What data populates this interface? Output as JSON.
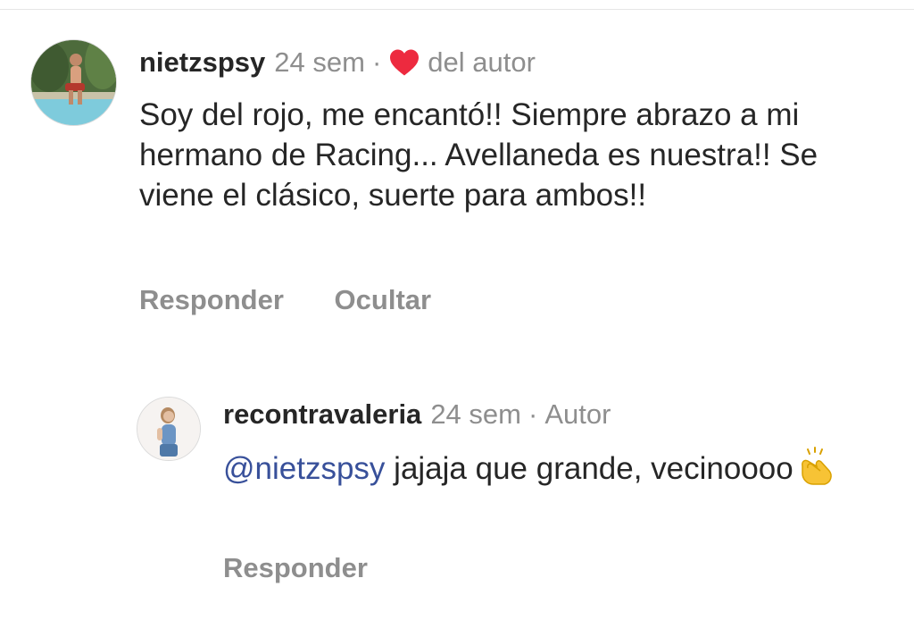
{
  "comments": [
    {
      "username": "nietzspsy",
      "time": "24 sem",
      "separator": "·",
      "liked_label": "del autor",
      "text": "Soy del rojo, me encantó!! Siempre abrazo a mi hermano de Racing... Avellaneda es nuestra!! Se viene el clásico, suerte para ambos!!",
      "actions": {
        "reply": "Responder",
        "hide": "Ocultar"
      },
      "avatar_icon": "user-avatar-pool"
    }
  ],
  "reply": {
    "username": "recontravaleria",
    "time": "24 sem",
    "separator": "·",
    "role": "Autor",
    "mention": "@nietzspsy",
    "text": " jajaja que grande, vecinoooo",
    "emoji_icon": "clapping-hands-icon",
    "actions": {
      "reply": "Responder"
    },
    "avatar_icon": "user-avatar-portrait"
  },
  "colors": {
    "heart": "#ed2a3f",
    "muted": "#8e8e8e",
    "mention": "#38509a",
    "text": "#262626"
  }
}
